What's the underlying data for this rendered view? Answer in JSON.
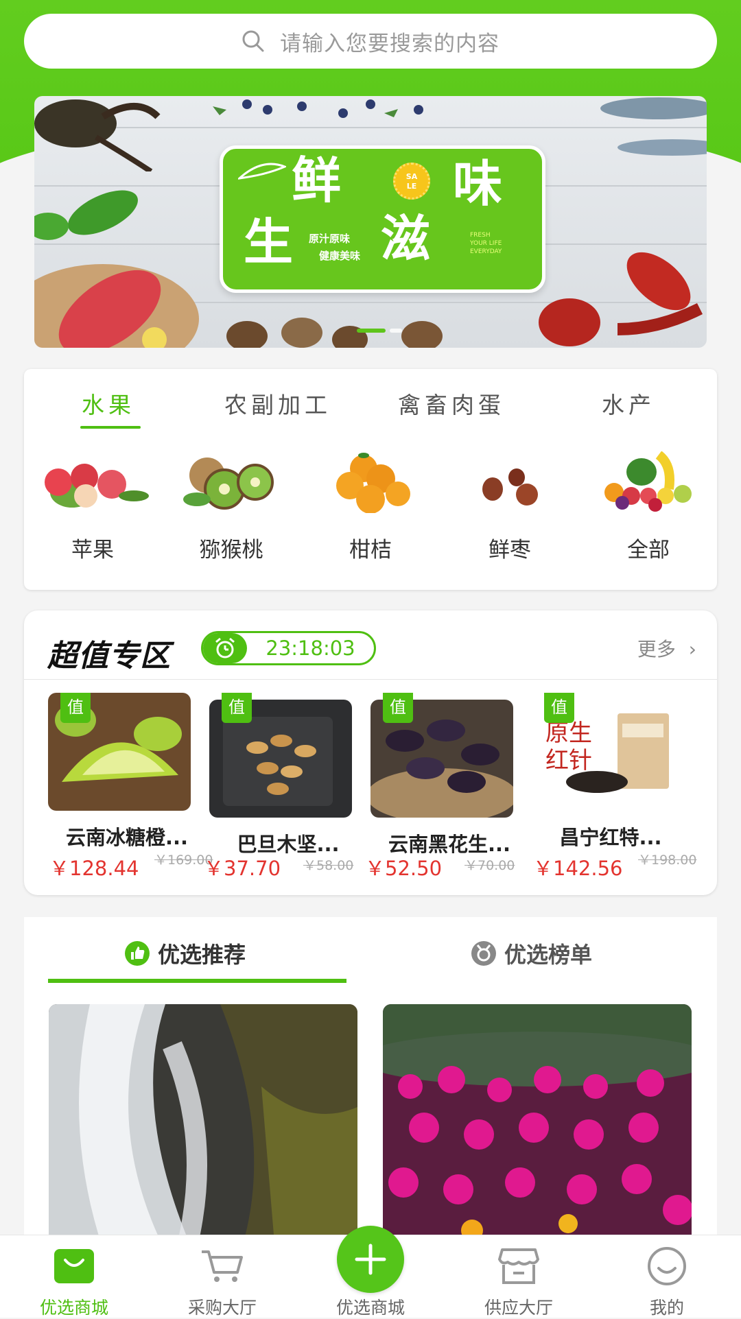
{
  "search": {
    "placeholder": "请输入您要搜索的内容"
  },
  "banner": {
    "char1": "鲜",
    "char2": "味",
    "char3": "生",
    "char4": "滋",
    "line1": "原汁原味",
    "line2": "健康美味",
    "tiny": "FRESH\nYOUR LIFE\nEVERYDAY",
    "sale": "SA\nLE"
  },
  "categories": {
    "tabs": [
      "水果",
      "农副加工",
      "禽畜肉蛋",
      "水产"
    ],
    "items": [
      "苹果",
      "猕猴桃",
      "柑桔",
      "鲜枣",
      "全部"
    ]
  },
  "deals": {
    "title": "超值专区",
    "timer": "23:18:03",
    "more": "更多",
    "tag": "值",
    "products": [
      {
        "name": "云南冰糖橙...",
        "price": "￥128.44",
        "old": "￥169.00"
      },
      {
        "name": "巴旦木坚...",
        "price": "￥37.70",
        "old": "￥58.00"
      },
      {
        "name": "云南黑花生...",
        "price": "￥52.50",
        "old": "￥70.00"
      },
      {
        "name": "昌宁红特...",
        "price": "￥142.56",
        "old": "￥198.00"
      }
    ]
  },
  "recommend": {
    "tab1": "优选推荐",
    "tab2": "优选榜单"
  },
  "nav": {
    "items": [
      "优选商城",
      "采购大厅",
      "优选商城",
      "供应大厅",
      "我的"
    ]
  },
  "colors": {
    "accent": "#4fbf12",
    "price": "#e3342f"
  }
}
